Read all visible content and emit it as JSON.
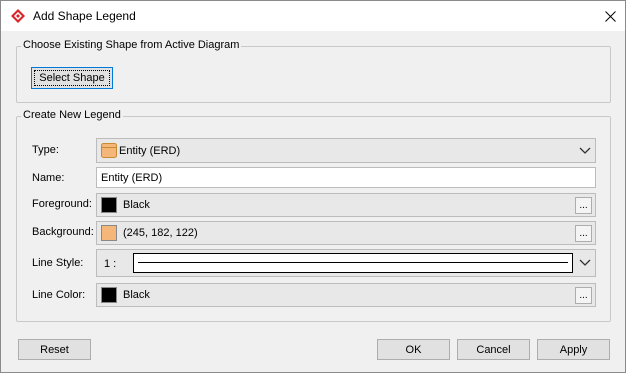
{
  "window": {
    "title": "Add Shape Legend"
  },
  "existing_group": {
    "title": "Choose Existing Shape from Active Diagram",
    "select_button": "Select Shape"
  },
  "new_group": {
    "title": "Create New Legend",
    "type": {
      "label": "Type:",
      "value": "Entity (ERD)",
      "icon": "entity-shape-icon"
    },
    "name": {
      "label": "Name:",
      "value": "Entity (ERD)"
    },
    "foreground": {
      "label": "Foreground:",
      "value": "Black",
      "color": "#000000",
      "button": "..."
    },
    "background": {
      "label": "Background:",
      "value": "(245, 182, 122)",
      "color": "#f5b67a",
      "button": "..."
    },
    "line_style": {
      "label": "Line Style:",
      "value": "1 :"
    },
    "line_color": {
      "label": "Line Color:",
      "value": "Black",
      "color": "#000000",
      "button": "..."
    }
  },
  "footer": {
    "reset": "Reset",
    "ok": "OK",
    "cancel": "Cancel",
    "apply": "Apply"
  }
}
